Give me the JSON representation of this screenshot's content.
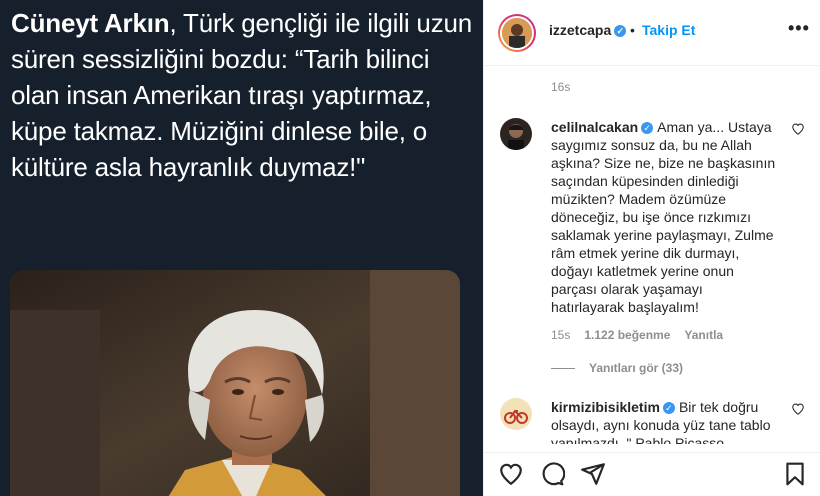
{
  "tweet": {
    "author": "Cüneyt Arkın",
    "text": ", Türk gençliği ile ilgili uzun süren sessizliğini bozdu: “Tarih bilinci olan insan Amerikan tıraşı yaptırmaz, küpe takmaz. Müziğini dinlese bile, o kültüre asla hayranlık duymaz!\""
  },
  "header": {
    "username": "izzetcapa",
    "verified_mark": "✓",
    "dot": "•",
    "follow_label": "Takip Et",
    "more_label": "•••"
  },
  "post": {
    "timestamp": "16s"
  },
  "comments": [
    {
      "username": "celilnalcakan",
      "text": "Aman ya... Ustaya saygımız sonsuz da, bu ne Allah aşkına? Size ne, bize ne başkasının saçından küpesinden dinlediği müzikten? Madem özümüze döneceğiz, bu işe önce rızkımızı saklamak yerine paylaşmayı, Zulme râm etmek yerine dik durmayı, doğayı katletmek yerine onun parçası olarak yaşamayı hatırlayarak başlayalım!",
      "time": "15s",
      "likes": "1.122 beğenme",
      "reply_label": "Yanıtla",
      "view_replies": "Yanıtları gör (33)"
    },
    {
      "username": "kirmizibisikletim",
      "text": "Bir tek doğru olsaydı, aynı konuda yüz tane tablo yapılmazdı. \" Pablo Picasso"
    }
  ],
  "icons": [
    "heart-icon",
    "comment-icon",
    "share-icon",
    "bookmark-icon",
    "small-heart-icon",
    "more-icon"
  ],
  "colors": {
    "accent": "#0095f6",
    "verified": "#3897f0",
    "tweet_bg": "#16202c"
  }
}
